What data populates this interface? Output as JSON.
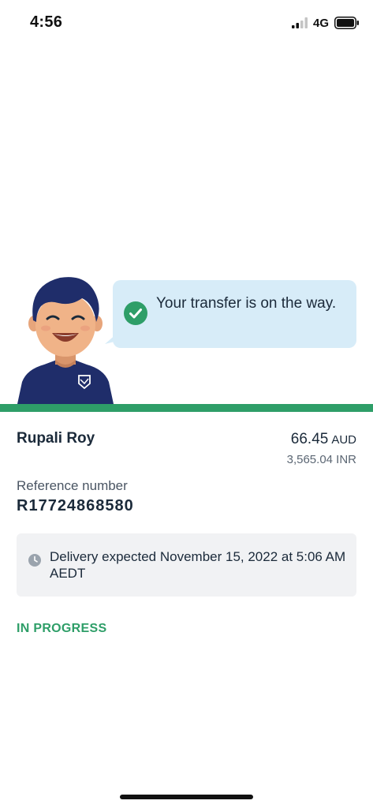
{
  "status_bar": {
    "time": "4:56",
    "network": "4G"
  },
  "hero": {
    "message": "Your transfer is on the way.",
    "accent_color": "#2e9e68",
    "bubble_color": "#d7ecf8"
  },
  "transfer": {
    "recipient_name": "Rupali Roy",
    "send_amount": "66.45",
    "send_currency": "AUD",
    "receive_amount": "3,565.04 INR",
    "reference_label": "Reference number",
    "reference_number": "R17724868580",
    "delivery_text": "Delivery expected November 15, 2022 at 5:06 AM AEDT",
    "status": "IN PROGRESS"
  },
  "icons": {
    "signal": "signal-icon",
    "battery": "battery-icon",
    "check": "check-circle-icon",
    "clock": "clock-icon",
    "avatar": "avatar-illustration"
  }
}
